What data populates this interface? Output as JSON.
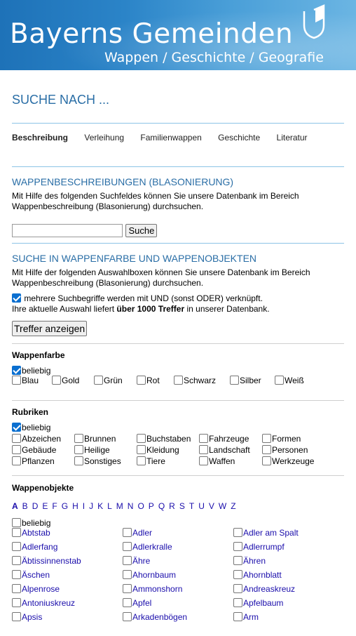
{
  "header": {
    "title": "Bayerns Gemeinden",
    "subtitle": "Wappen / Geschichte / Geografie"
  },
  "page_title": "SUCHE NACH ...",
  "tabs": [
    {
      "label": "Beschreibung",
      "active": true
    },
    {
      "label": "Verleihung"
    },
    {
      "label": "Familienwappen"
    },
    {
      "label": "Geschichte"
    },
    {
      "label": "Literatur"
    }
  ],
  "blasonierung": {
    "heading": "WAPPENBESCHREIBUNGEN (BLASONIERUNG)",
    "text": "Mit Hilfe des folgenden Suchfeldes können Sie unsere Datenbank im Bereich Wappenbeschreibung (Blasonierung) durchsuchen.",
    "search_value": "",
    "search_button": "Suche"
  },
  "farbe_objekte": {
    "heading": "SUCHE IN WAPPENFARBE UND WAPPENOBJEKTEN",
    "text": "Mit Hilfe der folgenden Auswahlboxen können Sie unsere Datenbank im Bereich Wappenbeschreibung (Blasonierung) durchsuchen.",
    "und_label": "mehrere Suchbegriffe werden mit UND (sonst ODER) verknüpft.",
    "und_checked": true,
    "result_prefix": "Ihre aktuelle Auswahl liefert ",
    "result_count": "über 1000 Treffer",
    "result_suffix": " in unserer Datenbank.",
    "show_button": "Treffer anzeigen"
  },
  "wappenfarbe": {
    "title": "Wappenfarbe",
    "any_label": "beliebig",
    "any_checked": true,
    "colors": [
      "Blau",
      "Gold",
      "Grün",
      "Rot",
      "Schwarz",
      "Silber",
      "Weiß"
    ]
  },
  "rubriken": {
    "title": "Rubriken",
    "any_label": "beliebig",
    "any_checked": true,
    "rows": [
      [
        "Abzeichen",
        "Brunnen",
        "Buchstaben",
        "Fahrzeuge",
        "Formen"
      ],
      [
        "Gebäude",
        "Heilige",
        "Kleidung",
        "Landschaft",
        "Personen"
      ],
      [
        "Pflanzen",
        "Sonstiges",
        "Tiere",
        "Waffen",
        "Werkzeuge"
      ]
    ]
  },
  "wappenobjekte": {
    "title": "Wappenobjekte",
    "letters": [
      "A",
      "B",
      "D",
      "E",
      "F",
      "G",
      "H",
      "I",
      "J",
      "K",
      "L",
      "M",
      "N",
      "O",
      "P",
      "Q",
      "R",
      "S",
      "T",
      "U",
      "V",
      "W",
      "Z"
    ],
    "active_letter": "A",
    "any_label": "beliebig",
    "rows": [
      [
        "Abtstab",
        "Adler",
        "Adler am Spalt"
      ],
      [
        "Adlerfang",
        "Adlerkralle",
        "Adlerrumpf"
      ],
      [
        "Äbtissinnenstab",
        "Ähre",
        "Ähren"
      ],
      [
        "Äschen",
        "Ahornbaum",
        "Ahornblatt"
      ],
      [
        "Alpenrose",
        "Ammonshorn",
        "Andreaskreuz"
      ],
      [
        "Antoniuskreuz",
        "Apfel",
        "Apfelbaum"
      ],
      [
        "Apsis",
        "Arkadenbögen",
        "Arm"
      ]
    ]
  }
}
